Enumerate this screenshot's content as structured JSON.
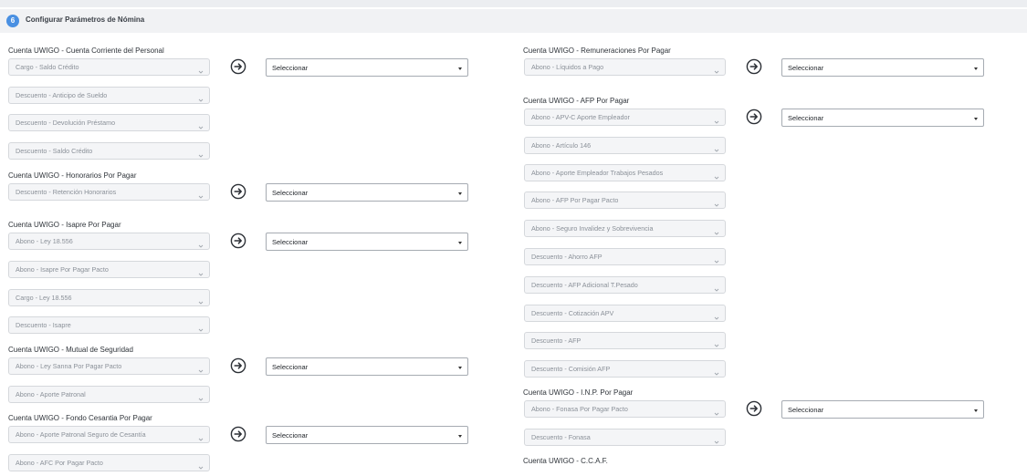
{
  "header": {
    "step": "6",
    "title": "Configurar Parámetros de Nómina"
  },
  "dropdown_default": "Seleccionar",
  "left_groups": [
    {
      "label": "Cuenta UWIGO - Cuenta Corriente del Personal",
      "fields": [
        "Cargo - Saldo Crédito",
        "Descuento - Anticipo de Sueldo",
        "Descuento - Devolución Préstamo",
        "Descuento - Saldo Crédito"
      ]
    },
    {
      "label": "Cuenta UWIGO - Honorarios Por Pagar",
      "fields": [
        "Descuento - Retención Honorarios"
      ]
    },
    {
      "label": "Cuenta UWIGO - Isapre Por Pagar",
      "fields": [
        "Abono - Ley 18.556",
        "Abono - Isapre Por Pagar Pacto",
        "Cargo - Ley 18.556",
        "Descuento - Isapre"
      ]
    },
    {
      "label": "Cuenta UWIGO - Mutual de Seguridad",
      "fields": [
        "Abono - Ley Sanna Por Pagar Pacto",
        "Abono - Aporte Patronal"
      ]
    },
    {
      "label": "Cuenta UWIGO - Fondo Cesantia Por Pagar",
      "fields": [
        "Abono - Aporte Patronal Seguro de Cesantía",
        "Abono - AFC Por Pagar Pacto"
      ]
    }
  ],
  "right_groups": [
    {
      "label": "Cuenta UWIGO - Remuneraciones Por Pagar",
      "fields": [
        "Abono - Líquidos a Pago"
      ]
    },
    {
      "label": "Cuenta UWIGO - AFP Por Pagar",
      "fields": [
        "Abono - APV-C Aporte Empleador",
        "Abono - Artículo 146",
        "Abono - Aporte Empleador Trabajos Pesados",
        "Abono - AFP Por Pagar Pacto",
        "Abono - Seguro Invalidez y Sobrevivencia",
        "Descuento - Ahorro AFP",
        "Descuento - AFP Adicional T.Pesado",
        "Descuento - Cotización APV",
        "Descuento - AFP",
        "Descuento - Comisión AFP"
      ]
    },
    {
      "label": "Cuenta UWIGO - I.N.P. Por Pagar",
      "fields": [
        "Abono - Fonasa Por Pagar Pacto",
        "Descuento - Fonasa"
      ]
    },
    {
      "label": "Cuenta UWIGO - C.C.A.F.",
      "fields": []
    }
  ]
}
